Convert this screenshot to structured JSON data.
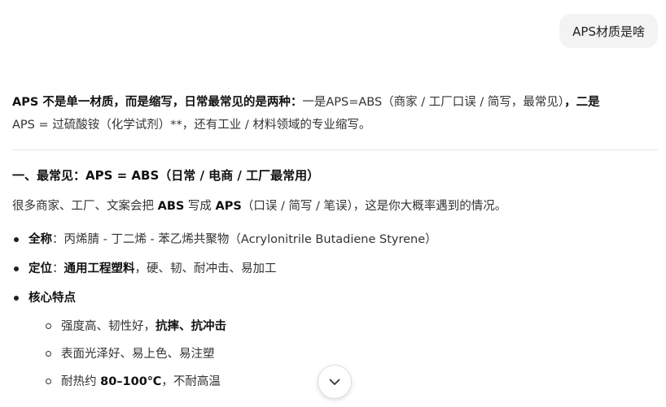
{
  "user_message": "APS材质是啥",
  "answer": {
    "intro": {
      "bold1": "APS 不是单一材质，而是缩写，日常最常见的是两种：",
      "text1": "一是APS=ABS（商家 / 工厂口误 / 简写，最常见）",
      "bold2": "，二是",
      "line2": "APS = 过硫酸铵（化学试剂）**，还有工业 / 材料领域的专业缩写。"
    },
    "section1": {
      "title": "一、最常见：APS = ABS（日常 / 电商 / 工厂最常用）",
      "para": {
        "t1": "很多商家、工厂、文案会把 ",
        "b1": "ABS",
        "t2": " 写成 ",
        "b2": "APS",
        "t3": "（口误 / 简写 / 笔误），这是你大概率遇到的情况。"
      },
      "bullets": [
        {
          "label": "全称",
          "sep": "：",
          "text": "丙烯腈 - 丁二烯 - 苯乙烯共聚物（Acrylonitrile Butadiene Styrene）"
        },
        {
          "label": "定位",
          "sep": "：",
          "bold_text": "通用工程塑料",
          "text": "，硬、韧、耐冲击、易加工"
        },
        {
          "label": "核心特点"
        }
      ],
      "sub_bullets": [
        {
          "text": "强度高、韧性好，",
          "bold": "抗摔、抗冲击"
        },
        {
          "text": "表面光泽好、易上色、易注塑"
        },
        {
          "text": "耐热约 ",
          "bold": "80–100℃",
          "text2": "，不耐高温"
        }
      ]
    }
  },
  "icons": {
    "scroll_down": "chevron-down-icon"
  }
}
